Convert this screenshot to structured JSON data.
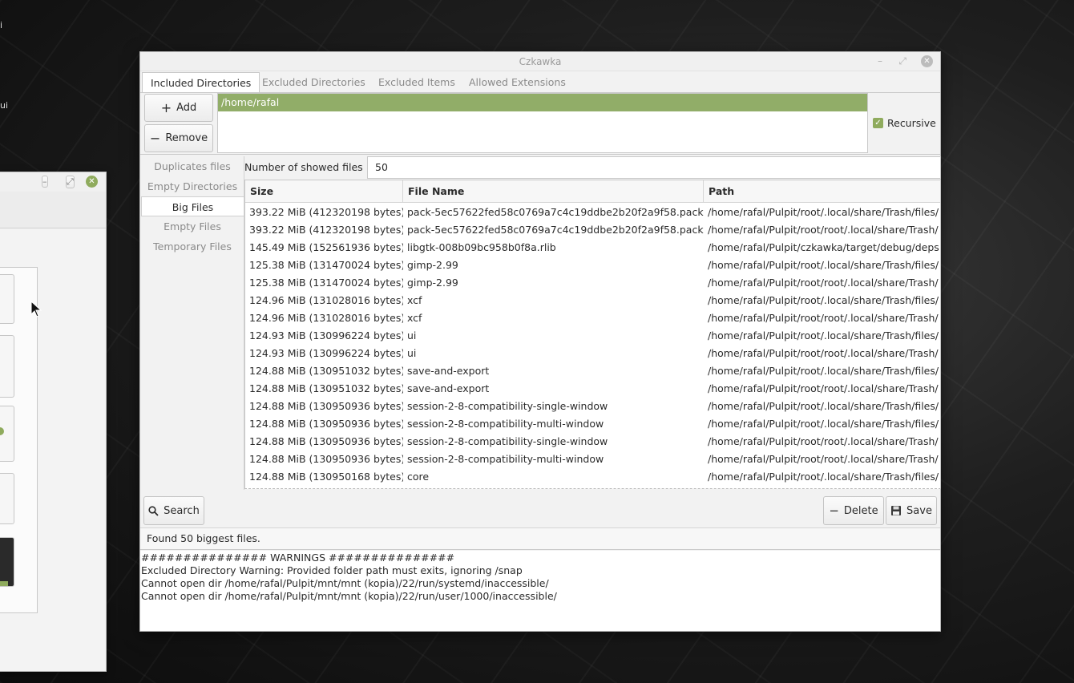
{
  "window": {
    "title": "Czkawka"
  },
  "desktop": {
    "labels": [
      "i",
      "ui"
    ]
  },
  "tabs": [
    {
      "label": "Included Directories",
      "active": true
    },
    {
      "label": "Excluded Directories",
      "active": false
    },
    {
      "label": "Excluded Items",
      "active": false
    },
    {
      "label": "Allowed Extensions",
      "active": false
    }
  ],
  "directories": {
    "add_label": "Add",
    "remove_label": "Remove",
    "items": [
      "/home/rafal"
    ],
    "recursive_label": "Recursive",
    "recursive_checked": true
  },
  "sidebar": {
    "items": [
      {
        "label": "Duplicates files",
        "active": false
      },
      {
        "label": "Empty Directories",
        "active": false
      },
      {
        "label": "Big Files",
        "active": true
      },
      {
        "label": "Empty Files",
        "active": false
      },
      {
        "label": "Temporary Files",
        "active": false
      }
    ]
  },
  "big_files": {
    "count_label": "Number of showed files",
    "count_value": "50",
    "columns": [
      "Size",
      "File Name",
      "Path"
    ],
    "rows": [
      [
        "393.22 MiB (412320198 bytes)",
        "pack-5ec57622fed58c0769a7c4c19ddbe2b20f2a9f58.pack",
        "/home/rafal/Pulpit/root/.local/share/Trash/files/"
      ],
      [
        "393.22 MiB (412320198 bytes)",
        "pack-5ec57622fed58c0769a7c4c19ddbe2b20f2a9f58.pack",
        "/home/rafal/Pulpit/root/root/.local/share/Trash/"
      ],
      [
        "145.49 MiB (152561936 bytes)",
        "libgtk-008b09bc958b0f8a.rlib",
        "/home/rafal/Pulpit/czkawka/target/debug/deps"
      ],
      [
        "125.38 MiB (131470024 bytes)",
        "gimp-2.99",
        "/home/rafal/Pulpit/root/.local/share/Trash/files/"
      ],
      [
        "125.38 MiB (131470024 bytes)",
        "gimp-2.99",
        "/home/rafal/Pulpit/root/root/.local/share/Trash/"
      ],
      [
        "124.96 MiB (131028016 bytes)",
        "xcf",
        "/home/rafal/Pulpit/root/.local/share/Trash/files/"
      ],
      [
        "124.96 MiB (131028016 bytes)",
        "xcf",
        "/home/rafal/Pulpit/root/root/.local/share/Trash/"
      ],
      [
        "124.93 MiB (130996224 bytes)",
        "ui",
        "/home/rafal/Pulpit/root/.local/share/Trash/files/"
      ],
      [
        "124.93 MiB (130996224 bytes)",
        "ui",
        "/home/rafal/Pulpit/root/root/.local/share/Trash/"
      ],
      [
        "124.88 MiB (130951032 bytes)",
        "save-and-export",
        "/home/rafal/Pulpit/root/.local/share/Trash/files/"
      ],
      [
        "124.88 MiB (130951032 bytes)",
        "save-and-export",
        "/home/rafal/Pulpit/root/root/.local/share/Trash/"
      ],
      [
        "124.88 MiB (130950936 bytes)",
        "session-2-8-compatibility-single-window",
        "/home/rafal/Pulpit/root/.local/share/Trash/files/"
      ],
      [
        "124.88 MiB (130950936 bytes)",
        "session-2-8-compatibility-multi-window",
        "/home/rafal/Pulpit/root/.local/share/Trash/files/"
      ],
      [
        "124.88 MiB (130950936 bytes)",
        "session-2-8-compatibility-single-window",
        "/home/rafal/Pulpit/root/root/.local/share/Trash/"
      ],
      [
        "124.88 MiB (130950936 bytes)",
        "session-2-8-compatibility-multi-window",
        "/home/rafal/Pulpit/root/root/.local/share/Trash/"
      ],
      [
        "124.88 MiB (130950168 bytes)",
        "core",
        "/home/rafal/Pulpit/root/.local/share/Trash/files/"
      ]
    ]
  },
  "actions": {
    "search_label": "Search",
    "delete_label": "Delete",
    "save_label": "Save"
  },
  "status": {
    "text": "Found 50 biggest files."
  },
  "log": {
    "lines": [
      "############### WARNINGS ###############",
      "Excluded Directory Warning: Provided folder path must exits, ignoring /snap",
      "Cannot open dir /home/rafal/Pulpit/mnt/mnt (kopia)/22/run/systemd/inaccessible/",
      "Cannot open dir /home/rafal/Pulpit/mnt/mnt (kopia)/22/run/user/1000/inaccessible/"
    ]
  },
  "colors": {
    "accent": "#91ad68",
    "window_bg": "#f2f2f2"
  },
  "icons": [
    "add-icon",
    "remove-icon",
    "check-icon",
    "search-icon",
    "delete-icon",
    "save-icon",
    "minimize-icon",
    "maximize-icon",
    "close-icon"
  ]
}
